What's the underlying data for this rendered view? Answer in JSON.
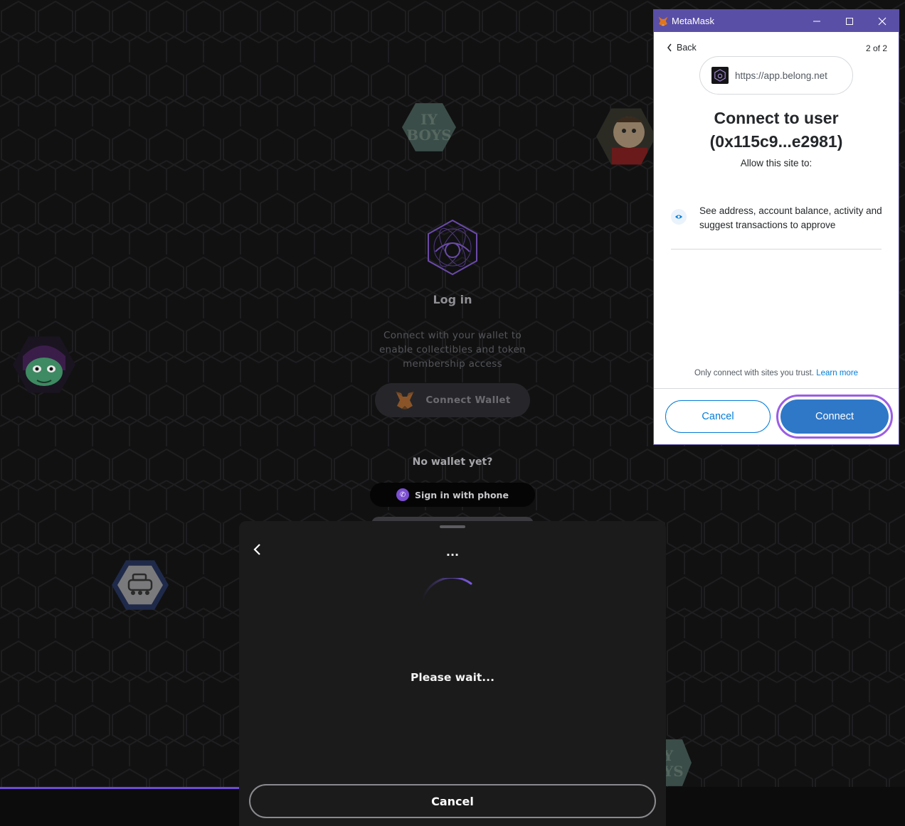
{
  "login": {
    "title": "Log in",
    "description": "Connect with your wallet to enable collectibles and token membership access",
    "connect_wallet_label": "Connect Wallet",
    "no_wallet_label": "No wallet yet?",
    "phone_signin_label": "Sign in with phone"
  },
  "avatars": {
    "top_center_text": "IY BOYS",
    "bottom_right_text": "Y YS"
  },
  "sheet": {
    "title": "...",
    "status": "Please wait...",
    "cancel_label": "Cancel"
  },
  "metamask": {
    "window_title": "MetaMask",
    "back_label": "Back",
    "step": "2 of 2",
    "site_url": "https://app.belong.net",
    "heading_line1": "Connect to user",
    "heading_line2": "(0x115c9...e2981)",
    "allow_label": "Allow this site to:",
    "permission_text": "See address, account balance, activity and suggest transactions to approve",
    "trust_text": "Only connect with sites you trust.",
    "learn_more_label": "Learn more",
    "cancel_label": "Cancel",
    "connect_label": "Connect"
  },
  "colors": {
    "accent_purple": "#7b4fd0",
    "metamask_blue": "#037dd6",
    "metamask_titlebar": "#5a4fa6"
  }
}
